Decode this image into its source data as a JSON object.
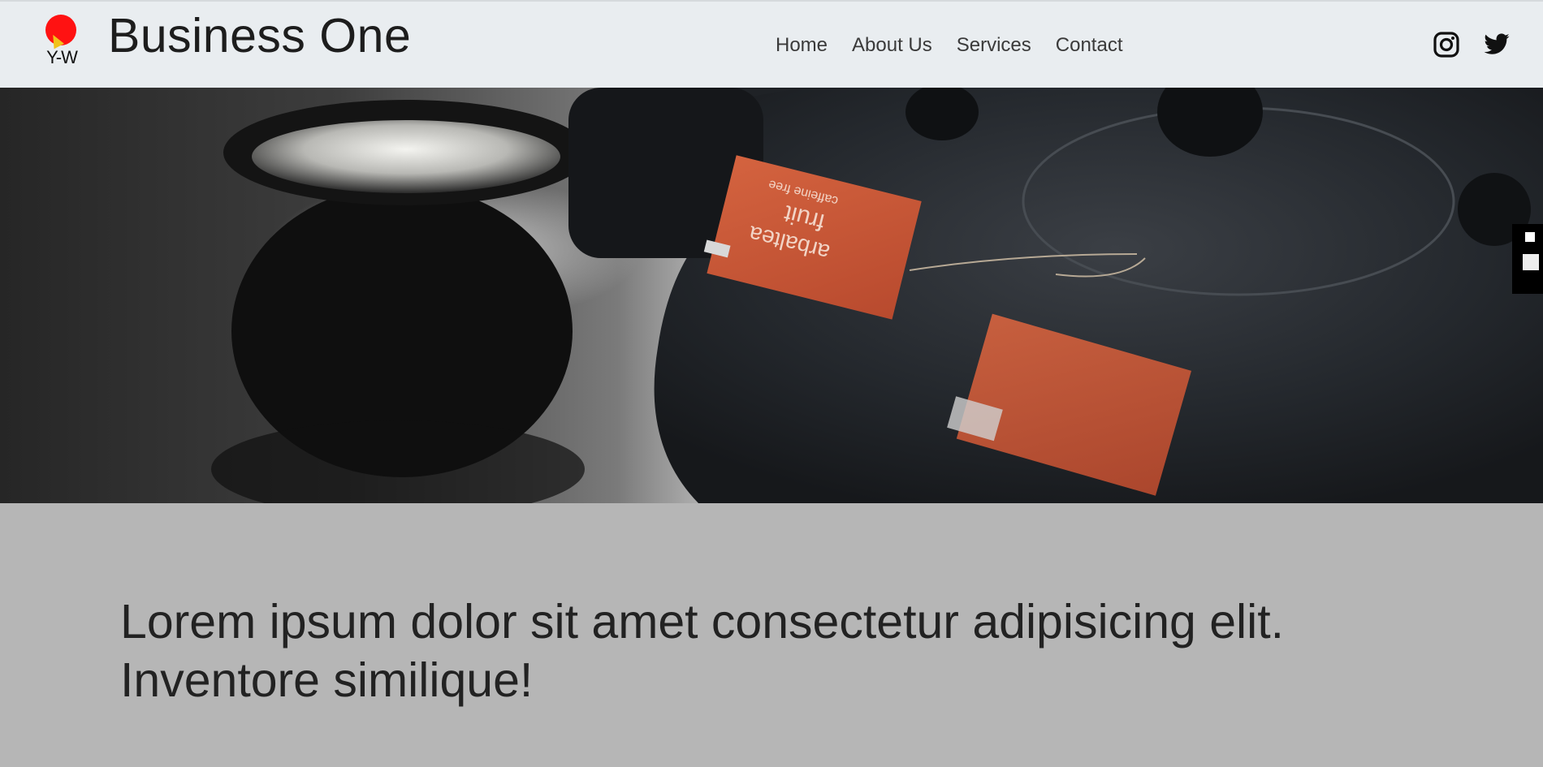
{
  "header": {
    "logo": {
      "mark_text": "Y-W",
      "colors": {
        "sun": "#ff1212",
        "flare": "#f1c21a"
      }
    },
    "brand_title": "Business One",
    "nav": [
      {
        "label": "Home"
      },
      {
        "label": "About Us"
      },
      {
        "label": "Services"
      },
      {
        "label": "Contact"
      }
    ],
    "social": [
      {
        "icon": "instagram-icon"
      },
      {
        "icon": "twitter-icon"
      }
    ]
  },
  "hero": {
    "image_text": {
      "tag_line1": "fruit",
      "tag_line2": "caffeine free",
      "tag_line3": "arbaltea"
    },
    "scroll_dots": 2
  },
  "content": {
    "headline_line1": "Lorem ipsum dolor sit amet consectetur adipisicing elit.",
    "headline_line2": "Inventore similique!"
  },
  "colors": {
    "header_bg": "#e9edf0",
    "content_bg": "#b6b6b6",
    "tag": "#c9573b"
  }
}
